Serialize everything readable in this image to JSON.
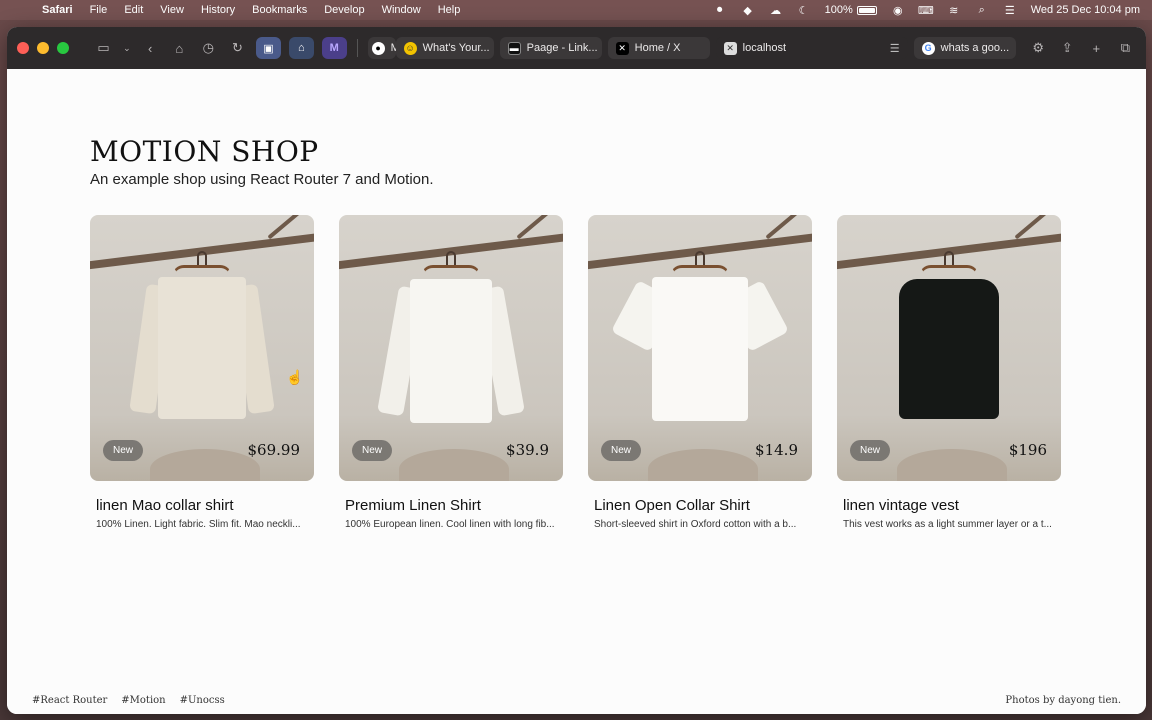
{
  "menubar": {
    "app_name": "Safari",
    "items": [
      "File",
      "Edit",
      "View",
      "History",
      "Bookmarks",
      "Develop",
      "Window",
      "Help"
    ],
    "battery_percent": "100%",
    "datetime": "Wed 25 Dec  10:04 pm"
  },
  "browser": {
    "pinned_tabs": [
      {
        "icon": "translate-icon"
      },
      {
        "icon": "home-app-icon"
      },
      {
        "icon": "m-app-icon",
        "label": "M"
      }
    ],
    "tabs": [
      {
        "favicon": "circle-app-icon",
        "label": "M"
      },
      {
        "favicon": "smiley-icon",
        "label": "What's Your..."
      },
      {
        "favicon": "terminal-icon",
        "label": "Paage - Link..."
      },
      {
        "favicon": "x-logo-icon",
        "label": "Home / X"
      },
      {
        "favicon": "close-square-icon",
        "label": "localhost",
        "active": true
      },
      {
        "favicon": "google-icon",
        "label": "whats a goo..."
      }
    ]
  },
  "page": {
    "title": "MOTION SHOP",
    "subtitle": "An example shop using React Router 7 and Motion.",
    "products": [
      {
        "name": "linen Mao collar shirt",
        "description": "100% Linen. Light fabric. Slim fit. Mao neckli...",
        "price": "$69.99",
        "badge": "New",
        "garment_color": "#e4ddcf"
      },
      {
        "name": "Premium Linen Shirt",
        "description": "100% European linen. Cool linen with long fib...",
        "price": "$39.9",
        "badge": "New",
        "garment_color": "#f2f0ea"
      },
      {
        "name": "Linen Open Collar Shirt",
        "description": "Short-sleeved shirt in Oxford cotton with a b...",
        "price": "$14.9",
        "badge": "New",
        "garment_color": "#f5f4ef"
      },
      {
        "name": "linen vintage vest",
        "description": "This vest works as a light summer layer or a t...",
        "price": "$196",
        "badge": "New",
        "garment_color": "#151816"
      }
    ],
    "footer_tags": [
      "#React Router",
      "#Motion",
      "#Unocss"
    ],
    "footer_credit": "Photos by dayong tien."
  }
}
